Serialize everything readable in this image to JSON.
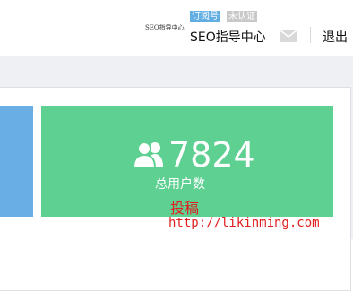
{
  "header": {
    "logo_small_text": "SEO指导中心",
    "badges": {
      "subscribe": "订阅号",
      "unverified": "未认证"
    },
    "account_name": "SEO指导中心",
    "logout_label": "退出",
    "icons": {
      "mail": "mail-icon"
    }
  },
  "stats": {
    "total_users": {
      "value": "7824",
      "label": "总用户数",
      "icon": "users-icon"
    }
  },
  "watermark": {
    "text": "投稿",
    "url": "http://likinming.com"
  },
  "colors": {
    "blue_card": "#6aaee6",
    "green_card": "#5ed091",
    "badge_subscribe": "#61aee2",
    "badge_unverified": "#c8c8c8",
    "watermark": "#e02020"
  }
}
